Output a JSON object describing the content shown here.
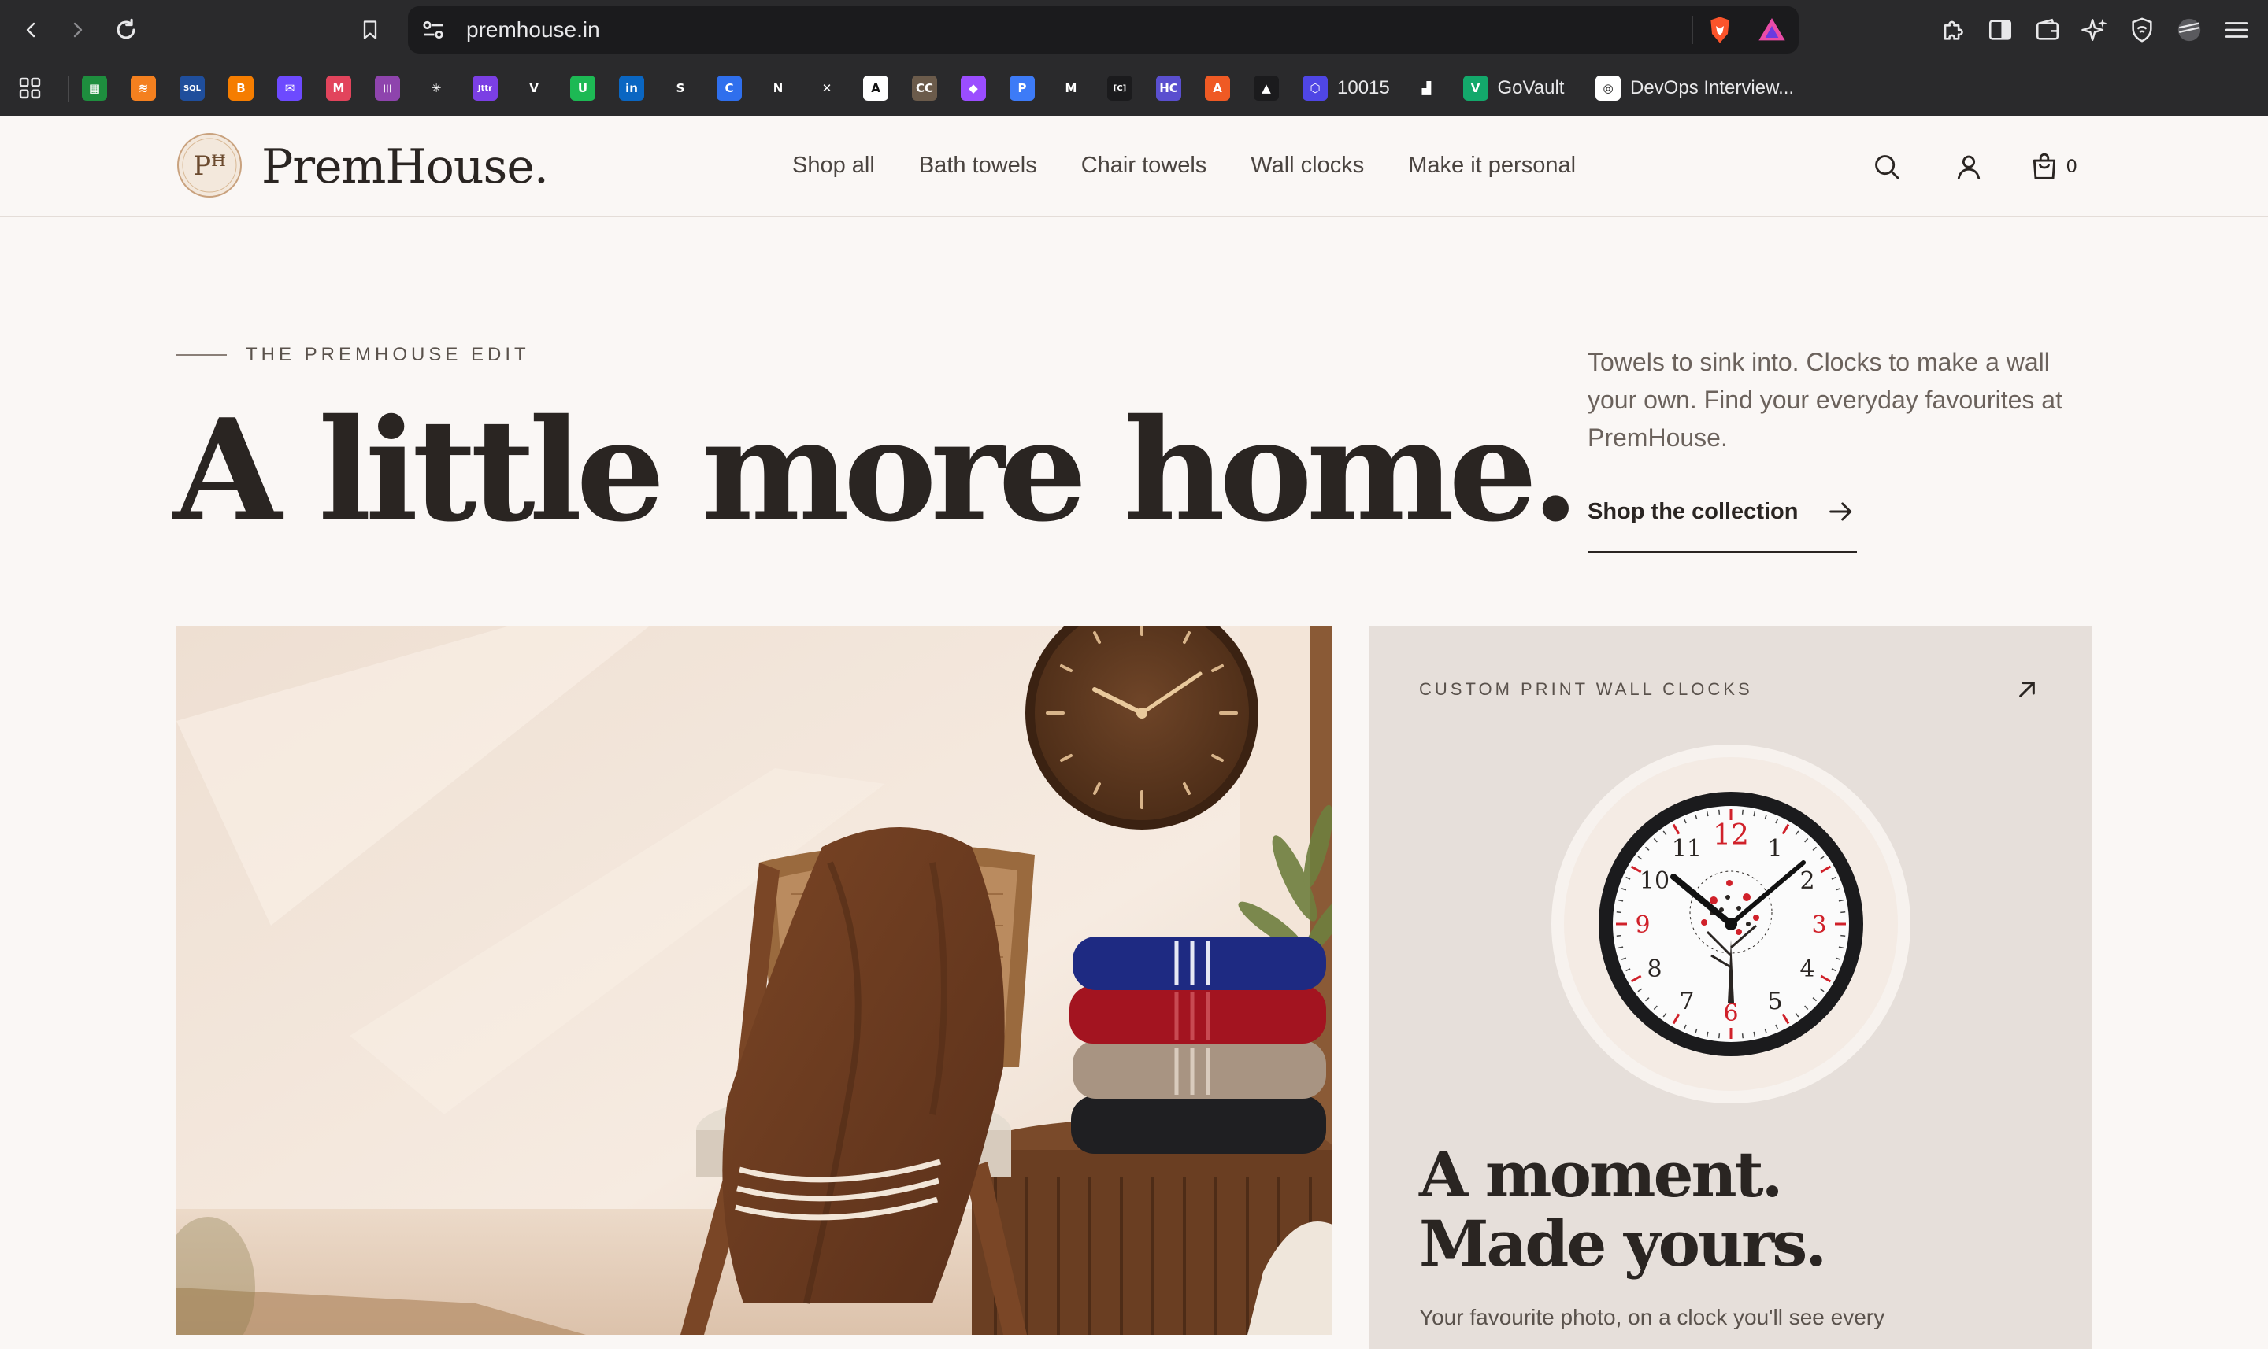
{
  "browser": {
    "url": "premhouse.in",
    "bookmarks": [
      {
        "icon": "apps-grid-icon",
        "label": ""
      },
      {
        "icon": "sheets-icon",
        "label": "",
        "color": "#1e8e3e",
        "glyph": "▦"
      },
      {
        "icon": "stack-icon",
        "label": "",
        "color": "#f4801f",
        "glyph": "≋"
      },
      {
        "icon": "sql-icon",
        "label": "",
        "color": "#1f4e9c",
        "glyph": "SQL"
      },
      {
        "icon": "blogger-icon",
        "label": "",
        "color": "#f57d00",
        "glyph": "B"
      },
      {
        "icon": "mail-icon",
        "label": "",
        "color": "#6d4aff",
        "glyph": "✉"
      },
      {
        "icon": "monday-icon",
        "label": "",
        "color": "#e2445c",
        "glyph": "M"
      },
      {
        "icon": "bars-icon",
        "label": "",
        "color": "#8e44ad",
        "glyph": "|||"
      },
      {
        "icon": "spark-icon",
        "label": "",
        "color": "#2a2a2c",
        "glyph": "✳"
      },
      {
        "icon": "jitter-icon",
        "label": "",
        "color": "#7b3fe4",
        "glyph": "Jttr"
      },
      {
        "icon": "vue-icon",
        "label": "",
        "color": "#2a2a2c",
        "glyph": "V"
      },
      {
        "icon": "u-icon",
        "label": "",
        "color": "#1db954",
        "glyph": "U"
      },
      {
        "icon": "linkedin-icon",
        "label": "",
        "color": "#0a66c2",
        "glyph": "in"
      },
      {
        "icon": "s-icon",
        "label": "",
        "color": "#2a2a2c",
        "glyph": "S"
      },
      {
        "icon": "c-icon",
        "label": "",
        "color": "#2f6fed",
        "glyph": "C"
      },
      {
        "icon": "n-icon",
        "label": "",
        "color": "#2a2a2c",
        "glyph": "N"
      },
      {
        "icon": "x-icon",
        "label": "",
        "color": "#2a2a2c",
        "glyph": "✕"
      },
      {
        "icon": "a-icon",
        "label": "",
        "color": "#ffffff",
        "glyph": "A"
      },
      {
        "icon": "cc-icon",
        "label": "",
        "color": "#6b5b4b",
        "glyph": "CC"
      },
      {
        "icon": "diamond-icon",
        "label": "",
        "color": "#9b4dff",
        "glyph": "◆"
      },
      {
        "icon": "p-icon",
        "label": "",
        "color": "#3d7bf7",
        "glyph": "P"
      },
      {
        "icon": "m-icon",
        "label": "",
        "color": "#2a2a2c",
        "glyph": "M"
      },
      {
        "icon": "code-icon",
        "label": "",
        "color": "#1b1b1d",
        "glyph": "[C]"
      },
      {
        "icon": "hc-icon",
        "label": "",
        "color": "#5a4fcf",
        "glyph": "HC"
      },
      {
        "icon": "a-orange-icon",
        "label": "",
        "color": "#ef5a24",
        "glyph": "A"
      },
      {
        "icon": "a-triangle-icon",
        "label": "",
        "color": "#1b1b1d",
        "glyph": "▲"
      },
      {
        "icon": "hex-icon",
        "label": "10015",
        "color": "#4f46e5",
        "glyph": "⬡"
      },
      {
        "icon": "building-icon",
        "label": "",
        "color": "#2a2a2c",
        "glyph": "▟"
      },
      {
        "icon": "govault-icon",
        "label": "GoVault",
        "color": "#13a86b",
        "glyph": "V"
      },
      {
        "icon": "openai-icon",
        "label": "DevOps Interview...",
        "color": "#ffffff",
        "glyph": "◎"
      }
    ]
  },
  "site": {
    "brand": "PremHouse.",
    "logo_mark": "Pꟸ",
    "nav": [
      "Shop all",
      "Bath towels",
      "Chair towels",
      "Wall clocks",
      "Make it personal"
    ],
    "cart_count": "0"
  },
  "hero": {
    "eyebrow": "THE PREMHOUSE EDIT",
    "title": "A little more home.",
    "copy": "Towels to sink into. Clocks to make a wall your own. Find your everyday favourites at PremHouse.",
    "cta": "Shop the collection"
  },
  "clock_card": {
    "eyebrow": "CUSTOM PRINT WALL CLOCKS",
    "title_line1": "A moment.",
    "title_line2": "Made yours.",
    "copy": "Your favourite photo, on a clock you'll see every",
    "clock_numbers": [
      "12",
      "1",
      "2",
      "3",
      "4",
      "5",
      "6",
      "7",
      "8",
      "9",
      "10",
      "11"
    ]
  },
  "colors": {
    "chrome_bg": "#2a2a2c",
    "page_bg": "#faf7f5",
    "text": "#2a2522",
    "card_bg": "#e6dfda",
    "towel_brown": "#6b3a1f"
  }
}
